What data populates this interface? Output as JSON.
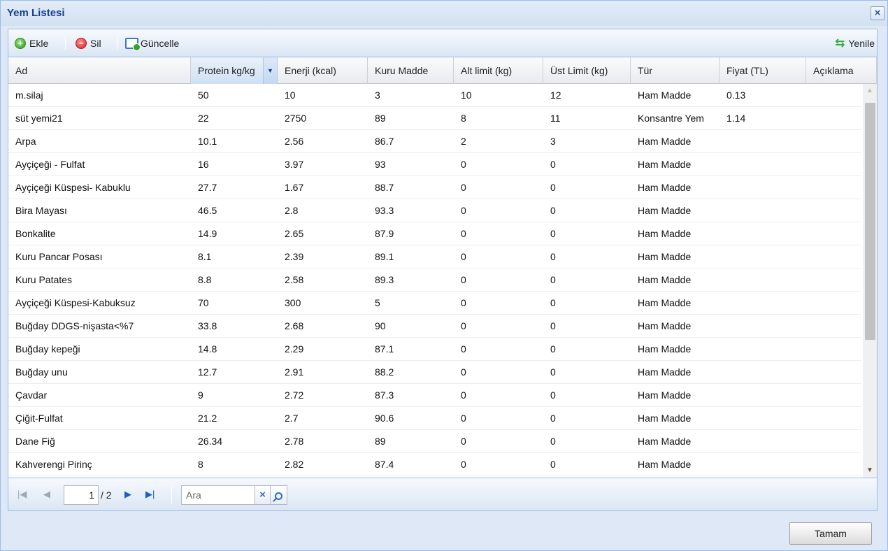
{
  "window": {
    "title": "Yem Listesi",
    "close_glyph": "×"
  },
  "toolbar": {
    "add_label": "Ekle",
    "delete_label": "Sil",
    "update_label": "Güncelle",
    "refresh_label": "Yenile",
    "add_glyph": "+",
    "delete_glyph": "−",
    "refresh_glyph": "⇆"
  },
  "grid": {
    "sort_glyph": "▼",
    "columns": [
      "Ad",
      "Protein kg/kg",
      "Enerji (kcal)",
      "Kuru Madde",
      "Alt limit (kg)",
      "Üst Limit (kg)",
      "Tür",
      "Fiyat (TL)",
      "Açıklama"
    ],
    "rows": [
      [
        "m.silaj",
        "50",
        "10",
        "3",
        "10",
        "12",
        "Ham Madde",
        "0.13",
        ""
      ],
      [
        "süt yemi21",
        "22",
        "2750",
        "89",
        "8",
        "11",
        "Konsantre Yem",
        "1.14",
        ""
      ],
      [
        "Arpa",
        "10.1",
        "2.56",
        "86.7",
        "2",
        "3",
        "Ham Madde",
        "",
        ""
      ],
      [
        "Ayçiçeği - Fulfat",
        "16",
        "3.97",
        "93",
        "0",
        "0",
        "Ham Madde",
        "",
        ""
      ],
      [
        "Ayçiçeği Küspesi- Kabuklu",
        "27.7",
        "1.67",
        "88.7",
        "0",
        "0",
        "Ham Madde",
        "",
        ""
      ],
      [
        "Bira Mayası",
        "46.5",
        "2.8",
        "93.3",
        "0",
        "0",
        "Ham Madde",
        "",
        ""
      ],
      [
        "Bonkalite",
        "14.9",
        "2.65",
        "87.9",
        "0",
        "0",
        "Ham Madde",
        "",
        ""
      ],
      [
        "Kuru Pancar Posası",
        "8.1",
        "2.39",
        "89.1",
        "0",
        "0",
        "Ham Madde",
        "",
        ""
      ],
      [
        "Kuru Patates",
        "8.8",
        "2.58",
        "89.3",
        "0",
        "0",
        "Ham Madde",
        "",
        ""
      ],
      [
        "Ayçiçeği Küspesi-Kabuksuz",
        "70",
        "300",
        "5",
        "0",
        "0",
        "Ham Madde",
        "",
        ""
      ],
      [
        "Buğday DDGS-nişasta<%7",
        "33.8",
        "2.68",
        "90",
        "0",
        "0",
        "Ham Madde",
        "",
        ""
      ],
      [
        "Buğday kepeği",
        "14.8",
        "2.29",
        "87.1",
        "0",
        "0",
        "Ham Madde",
        "",
        ""
      ],
      [
        "Buğday unu",
        "12.7",
        "2.91",
        "88.2",
        "0",
        "0",
        "Ham Madde",
        "",
        ""
      ],
      [
        "Çavdar",
        "9",
        "2.72",
        "87.3",
        "0",
        "0",
        "Ham Madde",
        "",
        ""
      ],
      [
        "Çiğit-Fulfat",
        "21.2",
        "2.7",
        "90.6",
        "0",
        "0",
        "Ham Madde",
        "",
        ""
      ],
      [
        "Dane Fiğ",
        "26.34",
        "2.78",
        "89",
        "0",
        "0",
        "Ham Madde",
        "",
        ""
      ],
      [
        "Kahverengi Pirinç",
        "8",
        "2.82",
        "87.4",
        "0",
        "0",
        "Ham Madde",
        "",
        ""
      ]
    ]
  },
  "scrollbar": {
    "up_glyph": "▲",
    "down_glyph": "▼"
  },
  "pager": {
    "page_value": "1",
    "total_label": "/ 2",
    "first_glyph": "|◀",
    "prev_glyph": "◀",
    "next_glyph": "▶",
    "last_glyph": "▶|",
    "search_placeholder": "Ara",
    "clear_glyph": "×"
  },
  "footer": {
    "ok_label": "Tamam"
  }
}
